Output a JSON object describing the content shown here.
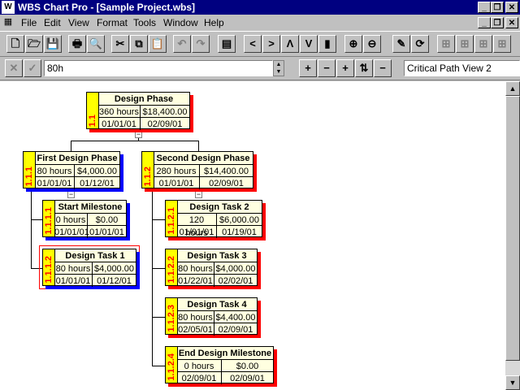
{
  "window": {
    "title": "WBS Chart Pro - [Sample Project.wbs]",
    "controls": [
      "_",
      "❐",
      "✕"
    ],
    "doc_controls": [
      "_",
      "❐",
      "✕"
    ]
  },
  "menu": [
    {
      "label": "File",
      "accel": "F"
    },
    {
      "label": "Edit",
      "accel": "E"
    },
    {
      "label": "View",
      "accel": "V"
    },
    {
      "label": "Format",
      "accel": "o"
    },
    {
      "label": "Tools",
      "accel": "T"
    },
    {
      "label": "Window",
      "accel": "W"
    },
    {
      "label": "Help",
      "accel": "H"
    }
  ],
  "toolbar": {
    "icons": [
      "new-icon",
      "open-icon",
      "save-icon",
      "print-icon",
      "print-preview-icon",
      "cut-icon",
      "copy-icon",
      "paste-icon",
      "undo-icon",
      "redo-icon",
      "properties-icon",
      "move-left-icon",
      "move-right-icon",
      "move-up-icon",
      "move-down-icon",
      "lock-icon",
      "zoom-in-icon",
      "zoom-out-icon",
      "tools-icon",
      "refresh-icon",
      "layout-1-icon",
      "layout-2-icon",
      "layout-3-icon",
      "layout-4-icon"
    ],
    "glyphs": [
      "🗋",
      "🗁",
      "💾",
      "🖶",
      "🔍",
      "✂",
      "⧉",
      "📋",
      "↶",
      "↷",
      "▤",
      "<",
      ">",
      "Λ",
      "V",
      "▮",
      "⊕",
      "⊖",
      "✎",
      "⟳",
      "⊞",
      "⊞",
      "⊞",
      "⊞"
    ]
  },
  "edit_bar": {
    "cancel_glyph": "✕",
    "accept_glyph": "✓",
    "value": "80h",
    "view_name": "Critical Path View 2",
    "node_buttons": [
      "+",
      "−",
      "+",
      "⇅",
      "−"
    ]
  },
  "nodes": [
    {
      "id": "1.1",
      "name": "Design Phase",
      "work": "360 hours",
      "cost": "$18,400.00",
      "start": "01/01/01",
      "finish": "02/09/01",
      "shadow": "#ff0000"
    },
    {
      "id": "1.1.1",
      "name": "First Design Phase",
      "work": "80 hours",
      "cost": "$4,000.00",
      "start": "01/01/01",
      "finish": "01/12/01",
      "shadow": "#0000ff"
    },
    {
      "id": "1.1.2",
      "name": "Second Design Phase",
      "work": "280 hours",
      "cost": "$14,400.00",
      "start": "01/01/01",
      "finish": "02/09/01",
      "shadow": "#ff0000"
    },
    {
      "id": "1.1.1.1",
      "name": "Start Milestone",
      "work": "0 hours",
      "cost": "$0.00",
      "start": "01/01/01",
      "finish": "01/01/01",
      "shadow": "#0000ff"
    },
    {
      "id": "1.1.1.2",
      "name": "Design Task 1",
      "work": "80 hours",
      "cost": "$4,000.00",
      "start": "01/01/01",
      "finish": "01/12/01",
      "shadow": "#0000ff"
    },
    {
      "id": "1.1.2.1",
      "name": "Design Task 2",
      "work": "120 hours",
      "cost": "$6,000.00",
      "start": "01/01/01",
      "finish": "01/19/01",
      "shadow": "#ff0000"
    },
    {
      "id": "1.1.2.2",
      "name": "Design Task 3",
      "work": "80 hours",
      "cost": "$4,000.00",
      "start": "01/22/01",
      "finish": "02/02/01",
      "shadow": "#ff0000"
    },
    {
      "id": "1.1.2.3",
      "name": "Design Task 4",
      "work": "80 hours",
      "cost": "$4,400.00",
      "start": "02/05/01",
      "finish": "02/09/01",
      "shadow": "#ff0000"
    },
    {
      "id": "1.1.2.4",
      "name": "End Design Milestone",
      "work": "0 hours",
      "cost": "$0.00",
      "start": "02/09/01",
      "finish": "02/09/01",
      "shadow": "#ff0000"
    }
  ]
}
